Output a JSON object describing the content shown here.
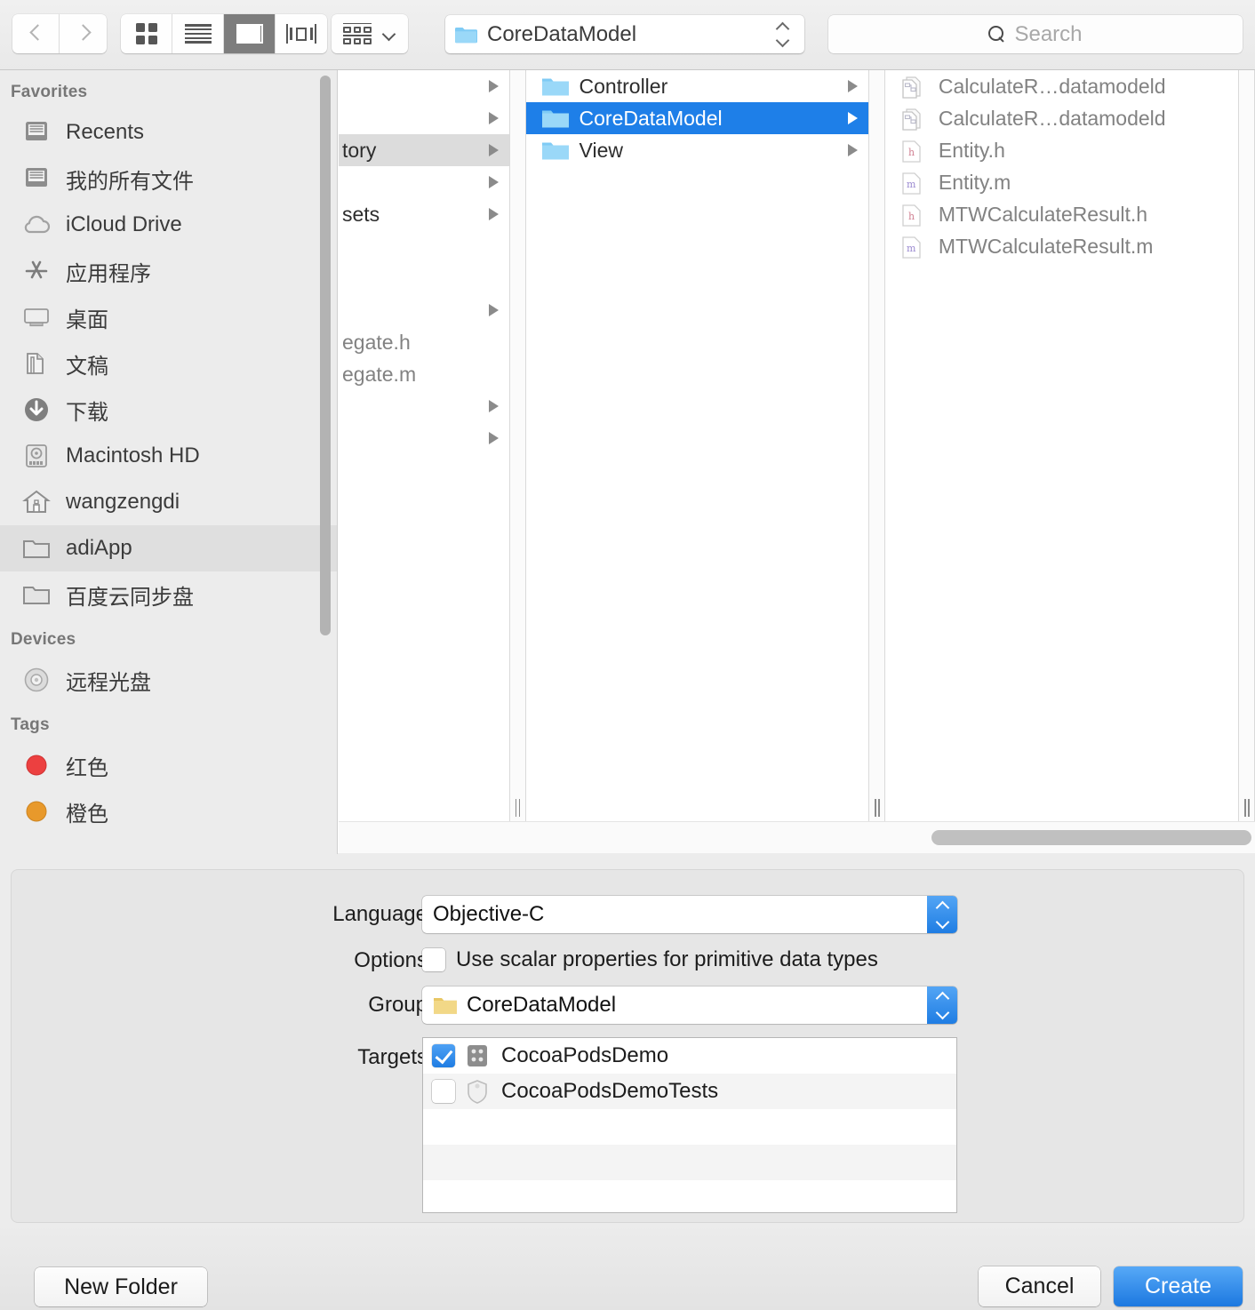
{
  "toolbar": {
    "nav": {
      "back_label": "Back",
      "forward_label": "Forward"
    },
    "view_modes": [
      {
        "name": "icon-view",
        "label": "Icon View",
        "selected": false
      },
      {
        "name": "list-view",
        "label": "List View",
        "selected": false
      },
      {
        "name": "column-view",
        "label": "Column View",
        "selected": true
      },
      {
        "name": "coverflow-view",
        "label": "Cover Flow View",
        "selected": false
      }
    ],
    "arrange_label": "Arrange",
    "path_popup": {
      "value": "CoreDataModel",
      "icon": "folder-icon"
    },
    "search": {
      "placeholder": "Search",
      "value": "",
      "icon": "search-icon"
    }
  },
  "sidebar": {
    "sections": [
      {
        "title": "Favorites",
        "items": [
          {
            "label": "Recents",
            "icon": "recents-icon",
            "selected": false
          },
          {
            "label": "我的所有文件",
            "icon": "all-files-icon",
            "selected": false
          },
          {
            "label": "iCloud Drive",
            "icon": "icloud-icon",
            "selected": false
          },
          {
            "label": "应用程序",
            "icon": "applications-icon",
            "selected": false
          },
          {
            "label": "桌面",
            "icon": "desktop-icon",
            "selected": false
          },
          {
            "label": "文稿",
            "icon": "documents-icon",
            "selected": false
          },
          {
            "label": "下载",
            "icon": "downloads-icon",
            "selected": false
          },
          {
            "label": "Macintosh HD",
            "icon": "harddisk-icon",
            "selected": false
          },
          {
            "label": "wangzengdi",
            "icon": "home-icon",
            "selected": false
          },
          {
            "label": "adiApp",
            "icon": "folder-icon",
            "selected": true
          },
          {
            "label": "百度云同步盘",
            "icon": "folder-icon",
            "selected": false
          }
        ]
      },
      {
        "title": "Devices",
        "items": [
          {
            "label": "远程光盘",
            "icon": "disc-icon",
            "selected": false
          }
        ]
      },
      {
        "title": "Tags",
        "items": [
          {
            "label": "红色",
            "icon": "tag-dot-icon",
            "color": "#ec4040",
            "selected": false
          },
          {
            "label": "橙色",
            "icon": "tag-dot-icon",
            "color": "#e8992b",
            "selected": false
          }
        ]
      }
    ]
  },
  "browser": {
    "columns": [
      {
        "name": "column-1",
        "clipped": true,
        "rows": [
          {
            "label": "",
            "has_arrow": true,
            "selected": false,
            "dim": false
          },
          {
            "label": "",
            "has_arrow": true,
            "selected": false,
            "dim": false
          },
          {
            "label": "tory",
            "has_arrow": true,
            "selected": true,
            "dim": false
          },
          {
            "label": "",
            "has_arrow": true,
            "selected": false,
            "dim": false
          },
          {
            "label": "sets",
            "has_arrow": true,
            "selected": false,
            "dim": false
          },
          {
            "label": "",
            "has_arrow": false,
            "selected": false,
            "dim": false
          },
          {
            "label": "",
            "has_arrow": false,
            "selected": false,
            "dim": false
          },
          {
            "label": "",
            "has_arrow": true,
            "selected": false,
            "dim": false
          },
          {
            "label": "egate.h",
            "has_arrow": false,
            "selected": false,
            "dim": true
          },
          {
            "label": "egate.m",
            "has_arrow": false,
            "selected": false,
            "dim": true
          },
          {
            "label": "",
            "has_arrow": true,
            "selected": false,
            "dim": false
          },
          {
            "label": "",
            "has_arrow": true,
            "selected": false,
            "dim": false
          }
        ]
      },
      {
        "name": "column-2",
        "clipped": false,
        "rows": [
          {
            "label": "Controller",
            "icon": "folder-icon",
            "has_arrow": true,
            "selected": false,
            "dim": false
          },
          {
            "label": "CoreDataModel",
            "icon": "folder-icon",
            "has_arrow": true,
            "selected": true,
            "dim": false
          },
          {
            "label": "View",
            "icon": "folder-icon",
            "has_arrow": true,
            "selected": false,
            "dim": false
          }
        ]
      },
      {
        "name": "column-3",
        "clipped": false,
        "rows": [
          {
            "label": "CalculateR…datamodeld",
            "icon": "datamodel-icon",
            "has_arrow": false,
            "selected": false,
            "dim": true
          },
          {
            "label": "CalculateR…datamodeld",
            "icon": "datamodel-icon",
            "has_arrow": false,
            "selected": false,
            "dim": true
          },
          {
            "label": "Entity.h",
            "icon": "h-file-icon",
            "has_arrow": false,
            "selected": false,
            "dim": true
          },
          {
            "label": "Entity.m",
            "icon": "m-file-icon",
            "has_arrow": false,
            "selected": false,
            "dim": true
          },
          {
            "label": "MTWCalculateResult.h",
            "icon": "h-file-icon",
            "has_arrow": false,
            "selected": false,
            "dim": true
          },
          {
            "label": "MTWCalculateResult.m",
            "icon": "m-file-icon",
            "has_arrow": false,
            "selected": false,
            "dim": true
          }
        ]
      }
    ]
  },
  "options": {
    "language": {
      "label": "Language",
      "value": "Objective-C"
    },
    "options_row": {
      "label": "Options",
      "checkbox_label": "Use scalar properties for primitive data types",
      "checked": false
    },
    "group": {
      "label": "Group",
      "value": "CoreDataModel",
      "icon": "folder-icon"
    },
    "targets": {
      "label": "Targets",
      "rows": [
        {
          "label": "CocoaPodsDemo",
          "icon": "app-target-icon",
          "checked": true
        },
        {
          "label": "CocoaPodsDemoTests",
          "icon": "test-target-icon",
          "checked": false
        },
        {
          "label": "",
          "icon": "",
          "checked": false
        },
        {
          "label": "",
          "icon": "",
          "checked": false
        },
        {
          "label": "",
          "icon": "",
          "checked": false
        }
      ]
    }
  },
  "footer": {
    "new_folder_label": "New Folder",
    "cancel_label": "Cancel",
    "create_label": "Create"
  },
  "colors": {
    "accent_blue": "#1e7fe8",
    "selection_gray": "#dcdcdc",
    "tag_red": "#ec4040",
    "tag_orange": "#e8992b"
  }
}
